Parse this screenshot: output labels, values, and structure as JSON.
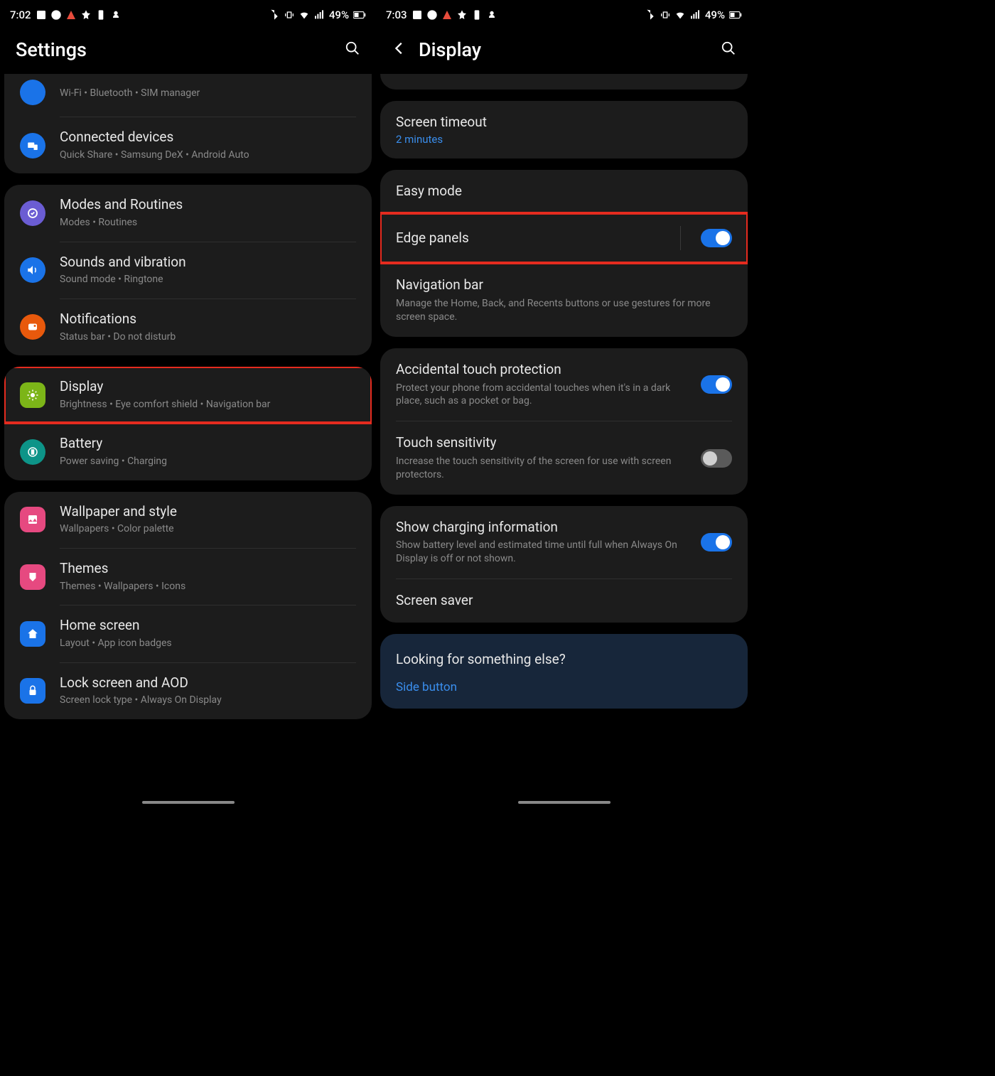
{
  "left": {
    "status": {
      "time": "7:02",
      "battery": "49%"
    },
    "header": {
      "title": "Settings"
    },
    "group0": {
      "connections_sub": "Wi-Fi  •  Bluetooth  •  SIM manager",
      "connected_title": "Connected devices",
      "connected_sub": "Quick Share  •  Samsung DeX  •  Android Auto"
    },
    "group1": {
      "modes_title": "Modes and Routines",
      "modes_sub": "Modes  •  Routines",
      "sounds_title": "Sounds and vibration",
      "sounds_sub": "Sound mode  •  Ringtone",
      "notif_title": "Notifications",
      "notif_sub": "Status bar  •  Do not disturb"
    },
    "group2": {
      "display_title": "Display",
      "display_sub": "Brightness  •  Eye comfort shield  •  Navigation bar",
      "battery_title": "Battery",
      "battery_sub": "Power saving  •  Charging"
    },
    "group3": {
      "wallpaper_title": "Wallpaper and style",
      "wallpaper_sub": "Wallpapers  •  Color palette",
      "themes_title": "Themes",
      "themes_sub": "Themes  •  Wallpapers  •  Icons",
      "home_title": "Home screen",
      "home_sub": "Layout  •  App icon badges",
      "lock_title": "Lock screen and AOD",
      "lock_sub": "Screen lock type  •  Always On Display"
    }
  },
  "right": {
    "status": {
      "time": "7:03",
      "battery": "49%"
    },
    "header": {
      "title": "Display"
    },
    "timeout": {
      "title": "Screen timeout",
      "value": "2 minutes"
    },
    "group1": {
      "easy_title": "Easy mode",
      "edge_title": "Edge panels",
      "nav_title": "Navigation bar",
      "nav_desc": "Manage the Home, Back, and Recents buttons or use gestures for more screen space."
    },
    "group2": {
      "accidental_title": "Accidental touch protection",
      "accidental_desc": "Protect your phone from accidental touches when it's in a dark place, such as a pocket or bag.",
      "touch_title": "Touch sensitivity",
      "touch_desc": "Increase the touch sensitivity of the screen for use with screen protectors."
    },
    "group3": {
      "charging_title": "Show charging information",
      "charging_desc": "Show battery level and estimated time until full when Always On Display is off or not shown.",
      "saver_title": "Screen saver"
    },
    "footer": {
      "title": "Looking for something else?",
      "link": "Side button"
    }
  }
}
